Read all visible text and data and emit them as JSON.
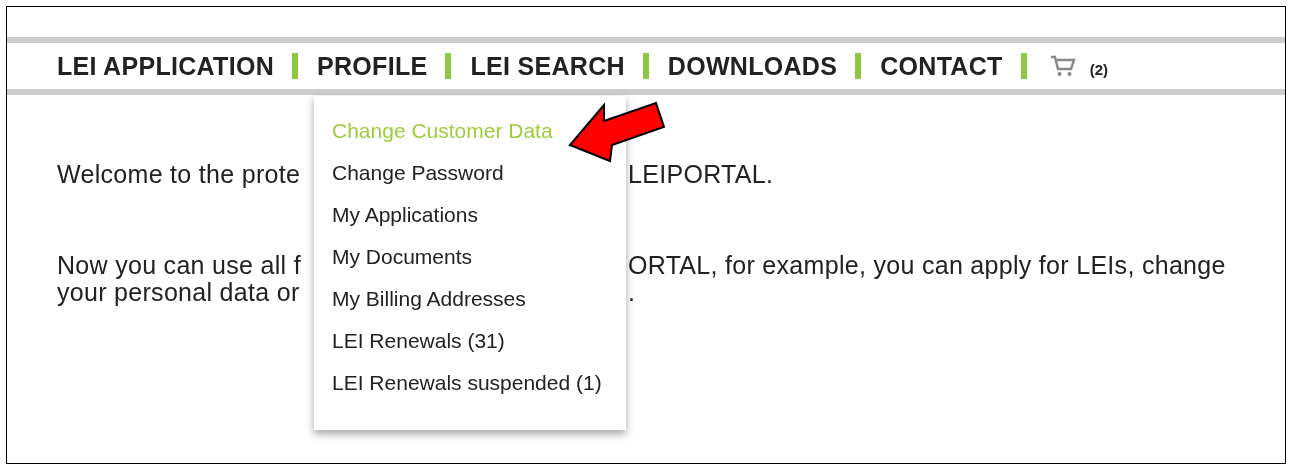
{
  "nav": {
    "items": [
      {
        "label": "LEI APPLICATION"
      },
      {
        "label": "PROFILE"
      },
      {
        "label": "LEI SEARCH"
      },
      {
        "label": "DOWNLOADS"
      },
      {
        "label": "CONTACT"
      }
    ],
    "cart": {
      "count": "(2)"
    }
  },
  "dropdown": {
    "items": [
      {
        "label": "Change Customer Data",
        "selected": true
      },
      {
        "label": "Change Password",
        "selected": false
      },
      {
        "label": "My Applications",
        "selected": false
      },
      {
        "label": "My Documents",
        "selected": false
      },
      {
        "label": "My Billing Addresses",
        "selected": false
      },
      {
        "label": "LEI Renewals (31)",
        "selected": false
      },
      {
        "label": "LEI Renewals suspended (1)",
        "selected": false
      }
    ]
  },
  "content": {
    "paragraphs": [
      {
        "lines": [
          {
            "left": "Welcome to the prote",
            "right": "LEIPORTAL."
          }
        ]
      },
      {
        "lines": [
          {
            "left": "Now you can use all f",
            "right": "ORTAL, for example, you can apply for LEIs, change"
          },
          {
            "left": "your personal data or",
            "right": "."
          }
        ]
      }
    ]
  }
}
